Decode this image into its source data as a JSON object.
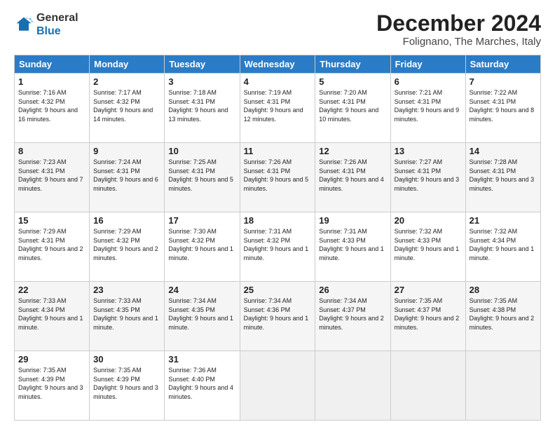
{
  "logo": {
    "general": "General",
    "blue": "Blue"
  },
  "header": {
    "title": "December 2024",
    "location": "Folignano, The Marches, Italy"
  },
  "weekdays": [
    "Sunday",
    "Monday",
    "Tuesday",
    "Wednesday",
    "Thursday",
    "Friday",
    "Saturday"
  ],
  "weeks": [
    [
      {
        "day": "1",
        "info": "Sunrise: 7:16 AM\nSunset: 4:32 PM\nDaylight: 9 hours and 16 minutes."
      },
      {
        "day": "2",
        "info": "Sunrise: 7:17 AM\nSunset: 4:32 PM\nDaylight: 9 hours and 14 minutes."
      },
      {
        "day": "3",
        "info": "Sunrise: 7:18 AM\nSunset: 4:31 PM\nDaylight: 9 hours and 13 minutes."
      },
      {
        "day": "4",
        "info": "Sunrise: 7:19 AM\nSunset: 4:31 PM\nDaylight: 9 hours and 12 minutes."
      },
      {
        "day": "5",
        "info": "Sunrise: 7:20 AM\nSunset: 4:31 PM\nDaylight: 9 hours and 10 minutes."
      },
      {
        "day": "6",
        "info": "Sunrise: 7:21 AM\nSunset: 4:31 PM\nDaylight: 9 hours and 9 minutes."
      },
      {
        "day": "7",
        "info": "Sunrise: 7:22 AM\nSunset: 4:31 PM\nDaylight: 9 hours and 8 minutes."
      }
    ],
    [
      {
        "day": "8",
        "info": "Sunrise: 7:23 AM\nSunset: 4:31 PM\nDaylight: 9 hours and 7 minutes."
      },
      {
        "day": "9",
        "info": "Sunrise: 7:24 AM\nSunset: 4:31 PM\nDaylight: 9 hours and 6 minutes."
      },
      {
        "day": "10",
        "info": "Sunrise: 7:25 AM\nSunset: 4:31 PM\nDaylight: 9 hours and 5 minutes."
      },
      {
        "day": "11",
        "info": "Sunrise: 7:26 AM\nSunset: 4:31 PM\nDaylight: 9 hours and 5 minutes."
      },
      {
        "day": "12",
        "info": "Sunrise: 7:26 AM\nSunset: 4:31 PM\nDaylight: 9 hours and 4 minutes."
      },
      {
        "day": "13",
        "info": "Sunrise: 7:27 AM\nSunset: 4:31 PM\nDaylight: 9 hours and 3 minutes."
      },
      {
        "day": "14",
        "info": "Sunrise: 7:28 AM\nSunset: 4:31 PM\nDaylight: 9 hours and 3 minutes."
      }
    ],
    [
      {
        "day": "15",
        "info": "Sunrise: 7:29 AM\nSunset: 4:31 PM\nDaylight: 9 hours and 2 minutes."
      },
      {
        "day": "16",
        "info": "Sunrise: 7:29 AM\nSunset: 4:32 PM\nDaylight: 9 hours and 2 minutes."
      },
      {
        "day": "17",
        "info": "Sunrise: 7:30 AM\nSunset: 4:32 PM\nDaylight: 9 hours and 1 minute."
      },
      {
        "day": "18",
        "info": "Sunrise: 7:31 AM\nSunset: 4:32 PM\nDaylight: 9 hours and 1 minute."
      },
      {
        "day": "19",
        "info": "Sunrise: 7:31 AM\nSunset: 4:33 PM\nDaylight: 9 hours and 1 minute."
      },
      {
        "day": "20",
        "info": "Sunrise: 7:32 AM\nSunset: 4:33 PM\nDaylight: 9 hours and 1 minute."
      },
      {
        "day": "21",
        "info": "Sunrise: 7:32 AM\nSunset: 4:34 PM\nDaylight: 9 hours and 1 minute."
      }
    ],
    [
      {
        "day": "22",
        "info": "Sunrise: 7:33 AM\nSunset: 4:34 PM\nDaylight: 9 hours and 1 minute."
      },
      {
        "day": "23",
        "info": "Sunrise: 7:33 AM\nSunset: 4:35 PM\nDaylight: 9 hours and 1 minute."
      },
      {
        "day": "24",
        "info": "Sunrise: 7:34 AM\nSunset: 4:35 PM\nDaylight: 9 hours and 1 minute."
      },
      {
        "day": "25",
        "info": "Sunrise: 7:34 AM\nSunset: 4:36 PM\nDaylight: 9 hours and 1 minute."
      },
      {
        "day": "26",
        "info": "Sunrise: 7:34 AM\nSunset: 4:37 PM\nDaylight: 9 hours and 2 minutes."
      },
      {
        "day": "27",
        "info": "Sunrise: 7:35 AM\nSunset: 4:37 PM\nDaylight: 9 hours and 2 minutes."
      },
      {
        "day": "28",
        "info": "Sunrise: 7:35 AM\nSunset: 4:38 PM\nDaylight: 9 hours and 2 minutes."
      }
    ],
    [
      {
        "day": "29",
        "info": "Sunrise: 7:35 AM\nSunset: 4:39 PM\nDaylight: 9 hours and 3 minutes."
      },
      {
        "day": "30",
        "info": "Sunrise: 7:35 AM\nSunset: 4:39 PM\nDaylight: 9 hours and 3 minutes."
      },
      {
        "day": "31",
        "info": "Sunrise: 7:36 AM\nSunset: 4:40 PM\nDaylight: 9 hours and 4 minutes."
      },
      null,
      null,
      null,
      null
    ]
  ]
}
